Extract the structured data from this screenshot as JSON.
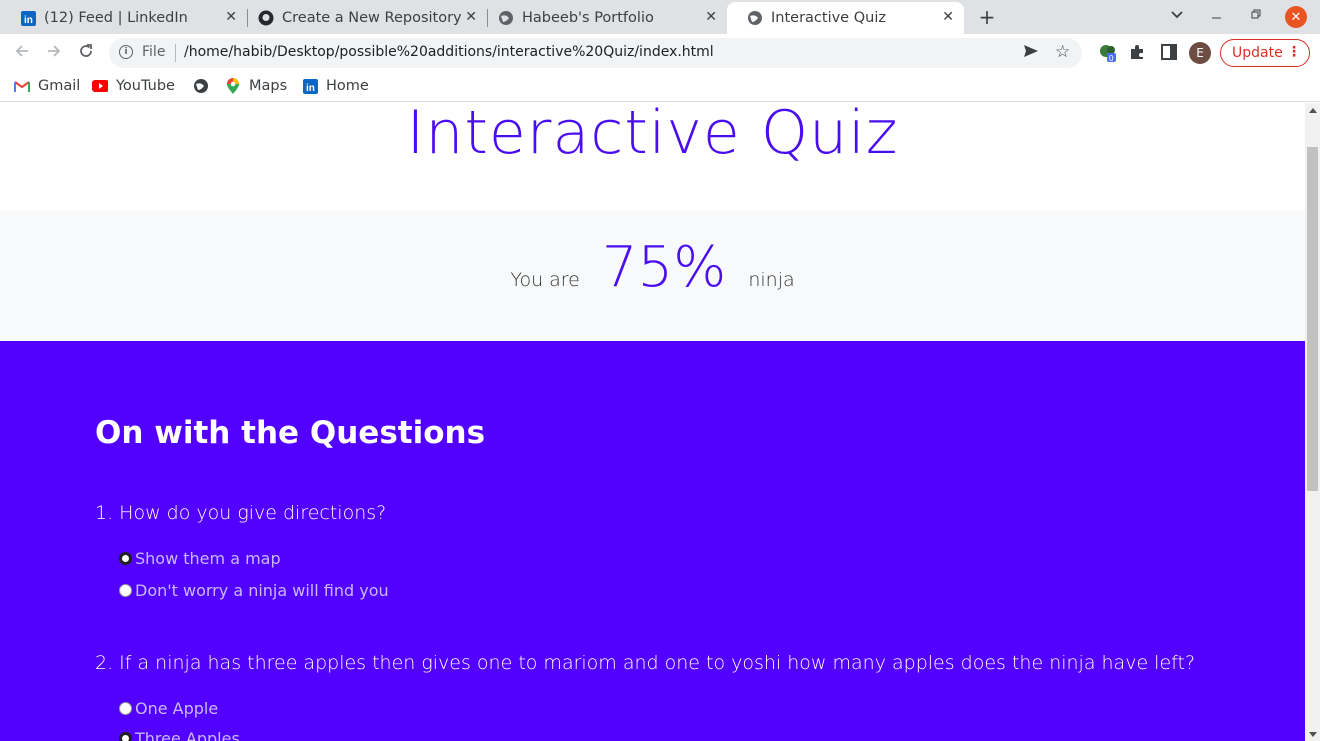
{
  "tabs": [
    {
      "title": "(12) Feed | LinkedIn",
      "icon": "linkedin-icon"
    },
    {
      "title": "Create a New Repository",
      "icon": "github-icon"
    },
    {
      "title": "Habeeb's Portfolio",
      "icon": "globe-icon"
    },
    {
      "title": "Interactive Quiz",
      "icon": "globe-icon",
      "active": true
    }
  ],
  "toolbar": {
    "info_label": "File",
    "url": "/home/habib/Desktop/possible%20additions/interactive%20Quiz/index.html",
    "profile_initial": "E",
    "update_label": "Update",
    "extension_badge": "0"
  },
  "bookmarks": [
    {
      "label": "Gmail",
      "icon": "gmail-icon"
    },
    {
      "label": "YouTube",
      "icon": "youtube-icon"
    },
    {
      "label": "",
      "icon": "globe-icon"
    },
    {
      "label": "Maps",
      "icon": "maps-icon"
    },
    {
      "label": "Home",
      "icon": "linkedin-icon"
    }
  ],
  "page": {
    "title": "Interactive Quiz",
    "result": {
      "prefix": "You are",
      "score": "75%",
      "suffix": "ninja"
    },
    "questions_heading": "On with the Questions",
    "questions": [
      {
        "text": "1. How do you give directions?",
        "options": [
          "Show them a map",
          "Don't worry a ninja will find you"
        ]
      },
      {
        "text": "2. If a ninja has three apples then gives one to mariom and one to yoshi how many apples does the ninja have left?",
        "options": [
          "One Apple",
          "Three Apples"
        ]
      }
    ]
  },
  "colors": {
    "accent": "#4a0df0",
    "questions_bg": "#5200ff",
    "result_bg": "#f8f9fa",
    "update": "#d93025"
  }
}
